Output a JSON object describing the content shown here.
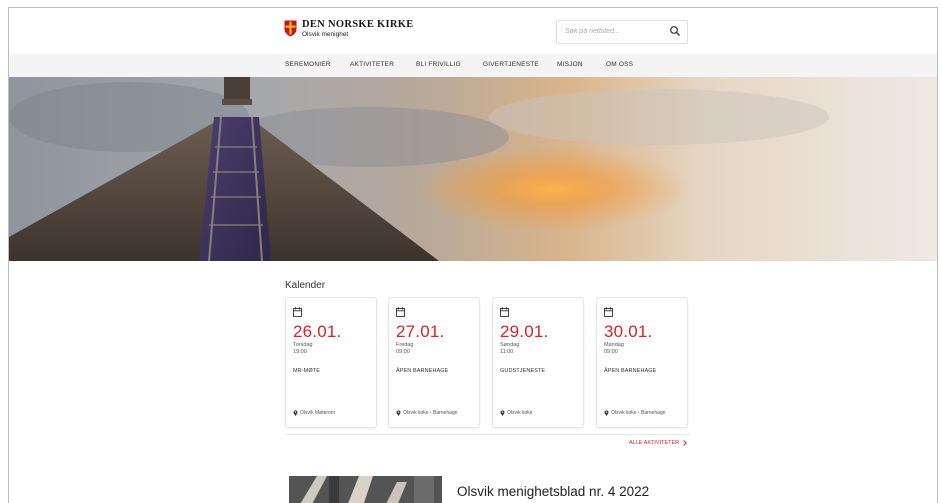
{
  "brand": {
    "name": "DEN NORSKE KIRKE",
    "parish": "Olsvik menighet",
    "shield_red": "#c8102e",
    "shield_gold": "#f2c200"
  },
  "search": {
    "placeholder": "Søk på nettsted...",
    "icon": "search-icon"
  },
  "nav": {
    "items": [
      {
        "label": "SEREMONIER"
      },
      {
        "label": "AKTIVITETER"
      },
      {
        "label": "BLI FRIVILLIG"
      },
      {
        "label": "GIVERTJENESTE"
      },
      {
        "label": "MISJON"
      },
      {
        "label": "OM OSS"
      }
    ]
  },
  "calendar": {
    "title": "Kalender",
    "accent": "#d8232a",
    "events": [
      {
        "date": "26.01.",
        "day": "Torsdag",
        "time": "19:00",
        "name": "MR-MØTE",
        "location": "Olsvik Møterom"
      },
      {
        "date": "27.01.",
        "day": "Fredag",
        "time": "09:00",
        "name": "ÅPEN BARNEHAGE",
        "location": "Olsvik kirke - Barnehage"
      },
      {
        "date": "29.01.",
        "day": "Søndag",
        "time": "11:00",
        "name": "GUDSTJENESTE",
        "location": "Olsvik kirke"
      },
      {
        "date": "30.01.",
        "day": "Mandag",
        "time": "09:00",
        "name": "ÅPEN BARNEHAGE",
        "location": "Olsvik kirke - Barnehage"
      }
    ],
    "all_link": "ALLE AKTIVITETER"
  },
  "news": {
    "title": "Olsvik menighetsblad nr. 4 2022"
  }
}
